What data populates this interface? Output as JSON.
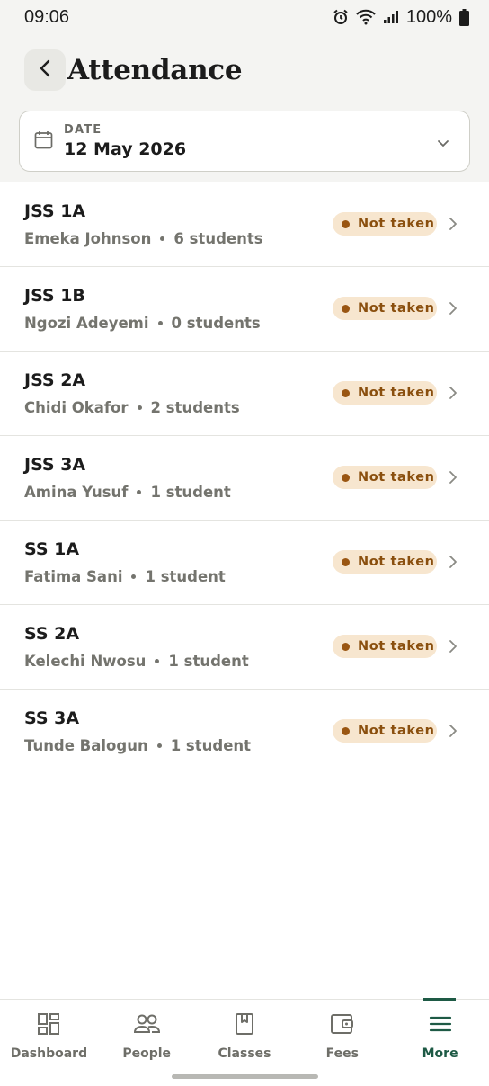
{
  "status_bar": {
    "time": "09:06",
    "battery": "100%"
  },
  "header": {
    "title": "Attendance"
  },
  "date_picker": {
    "label": "DATE",
    "value": "12 May 2026"
  },
  "classes": [
    {
      "name": "JSS 1A",
      "teacher": "Emeka Johnson",
      "students": "6 students",
      "status": "Not taken"
    },
    {
      "name": "JSS 1B",
      "teacher": "Ngozi Adeyemi",
      "students": "0 students",
      "status": "Not taken"
    },
    {
      "name": "JSS 2A",
      "teacher": "Chidi Okafor",
      "students": "2 students",
      "status": "Not taken"
    },
    {
      "name": "JSS 3A",
      "teacher": "Amina Yusuf",
      "students": "1 student",
      "status": "Not taken"
    },
    {
      "name": "SS 1A",
      "teacher": "Fatima Sani",
      "students": "1 student",
      "status": "Not taken"
    },
    {
      "name": "SS 2A",
      "teacher": "Kelechi Nwosu",
      "students": "1 student",
      "status": "Not taken"
    },
    {
      "name": "SS 3A",
      "teacher": "Tunde Balogun",
      "students": "1 student",
      "status": "Not taken"
    }
  ],
  "bottom_nav": [
    {
      "label": "Dashboard",
      "icon": "dashboard-icon"
    },
    {
      "label": "People",
      "icon": "people-icon"
    },
    {
      "label": "Classes",
      "icon": "classes-icon"
    },
    {
      "label": "Fees",
      "icon": "wallet-icon"
    },
    {
      "label": "More",
      "icon": "menu-icon",
      "active": true
    }
  ],
  "colors": {
    "accent": "#1e5a45",
    "badge_bg": "#f7e6cf",
    "badge_text": "#8a4f0e"
  }
}
